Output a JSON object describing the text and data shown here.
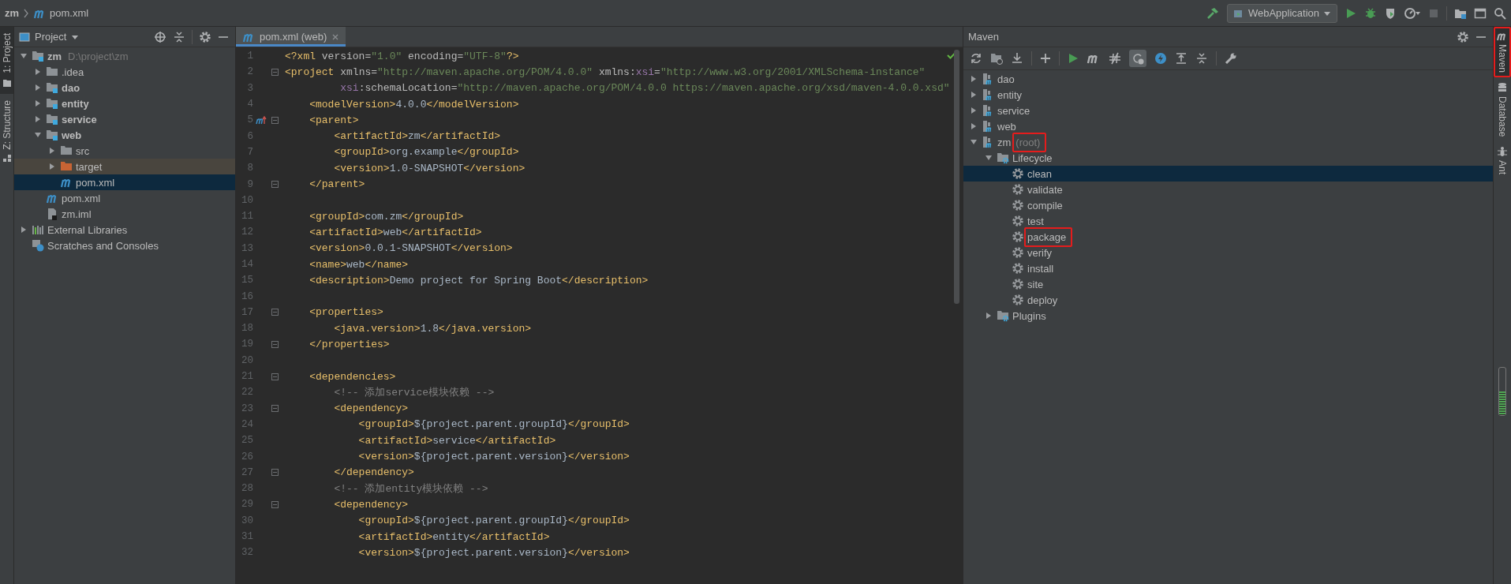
{
  "top_bar": {
    "breadcrumbs": [
      {
        "label": "zm",
        "kind": "project"
      },
      {
        "label": "pom.xml",
        "kind": "pom"
      }
    ],
    "run_config": "WebApplication"
  },
  "left_stripe": [
    {
      "label": "1: Project",
      "selected": true,
      "kind": "project"
    },
    {
      "label": "Z: Structure",
      "selected": false,
      "kind": "structure"
    }
  ],
  "project_panel": {
    "title": "Project",
    "tree": [
      {
        "label": "zm",
        "hint": "D:\\project\\zm",
        "kind": "module",
        "expanded": true,
        "selected": false,
        "children": [
          {
            "label": ".idea",
            "kind": "folder",
            "expanded": false,
            "selected": false
          },
          {
            "label": "dao",
            "kind": "module",
            "expanded": false,
            "selected": false
          },
          {
            "label": "entity",
            "kind": "module",
            "expanded": false,
            "selected": false
          },
          {
            "label": "service",
            "kind": "module",
            "expanded": false,
            "selected": false
          },
          {
            "label": "web",
            "kind": "module",
            "expanded": true,
            "selected": false,
            "children": [
              {
                "label": "src",
                "kind": "folder",
                "expanded": false,
                "selected": false
              },
              {
                "label": "target",
                "kind": "excluded",
                "expanded": false,
                "selected": false
              },
              {
                "label": "pom.xml",
                "kind": "pom",
                "selected": true
              }
            ]
          },
          {
            "label": "pom.xml",
            "kind": "pom",
            "selected": false
          },
          {
            "label": "zm.iml",
            "kind": "iml",
            "selected": false
          }
        ]
      },
      {
        "label": "External Libraries",
        "kind": "libraries",
        "expanded": false,
        "selected": false
      },
      {
        "label": "Scratches and Consoles",
        "kind": "scratches",
        "selected": false
      }
    ]
  },
  "editor": {
    "tabs": [
      {
        "label": "pom.xml (web)",
        "selected": true
      }
    ],
    "lines": [
      {
        "number": "1",
        "fold": false,
        "override": false,
        "tokens": [
          {
            "kind": "t",
            "text": "<?xml"
          },
          {
            "kind": "a",
            "text": " version="
          },
          {
            "kind": "v",
            "text": "\"1.0\""
          },
          {
            "kind": "a",
            "text": " encoding="
          },
          {
            "kind": "v",
            "text": "\"UTF-8\""
          },
          {
            "kind": "t",
            "text": "?>"
          }
        ]
      },
      {
        "number": "2",
        "fold": true,
        "override": false,
        "tokens": [
          {
            "kind": "t",
            "text": "<project"
          },
          {
            "kind": "a",
            "text": " xmlns="
          },
          {
            "kind": "v",
            "text": "\"http://maven.apache.org/POM/4.0.0\""
          },
          {
            "kind": "a",
            "text": " xmlns:"
          },
          {
            "kind": "n",
            "text": "xsi"
          },
          {
            "kind": "a",
            "text": "="
          },
          {
            "kind": "v",
            "text": "\"http://www.w3.org/2001/XMLSchema-instance\""
          }
        ]
      },
      {
        "number": "3",
        "fold": false,
        "override": false,
        "tokens": [
          {
            "kind": "n",
            "text": "         xsi"
          },
          {
            "kind": "a",
            "text": ":schemaLocation="
          },
          {
            "kind": "v",
            "text": "\"http://maven.apache.org/POM/4.0.0 https://maven.apache.org/xsd/maven-4.0.0.xsd\""
          }
        ]
      },
      {
        "number": "4",
        "fold": false,
        "override": false,
        "tokens": [
          {
            "kind": "t",
            "text": "    <modelVersion>"
          },
          {
            "kind": "x",
            "text": "4.0.0"
          },
          {
            "kind": "t",
            "text": "</modelVersion>"
          }
        ]
      },
      {
        "number": "5",
        "fold": true,
        "override": true,
        "tokens": [
          {
            "kind": "t",
            "text": "    <parent>"
          }
        ]
      },
      {
        "number": "6",
        "fold": false,
        "override": false,
        "tokens": [
          {
            "kind": "t",
            "text": "        <artifactId>"
          },
          {
            "kind": "x",
            "text": "zm"
          },
          {
            "kind": "t",
            "text": "</artifactId>"
          }
        ]
      },
      {
        "number": "7",
        "fold": false,
        "override": false,
        "tokens": [
          {
            "kind": "t",
            "text": "        <groupId>"
          },
          {
            "kind": "x",
            "text": "org.example"
          },
          {
            "kind": "t",
            "text": "</groupId>"
          }
        ]
      },
      {
        "number": "8",
        "fold": false,
        "override": false,
        "tokens": [
          {
            "kind": "t",
            "text": "        <version>"
          },
          {
            "kind": "x",
            "text": "1.0-SNAPSHOT"
          },
          {
            "kind": "t",
            "text": "</version>"
          }
        ]
      },
      {
        "number": "9",
        "fold": true,
        "override": false,
        "tokens": [
          {
            "kind": "t",
            "text": "    </parent>"
          }
        ]
      },
      {
        "number": "10",
        "fold": false,
        "override": false
      },
      {
        "number": "11",
        "fold": false,
        "override": false,
        "tokens": [
          {
            "kind": "t",
            "text": "    <groupId>"
          },
          {
            "kind": "x",
            "text": "com.zm"
          },
          {
            "kind": "t",
            "text": "</groupId>"
          }
        ]
      },
      {
        "number": "12",
        "fold": false,
        "override": false,
        "tokens": [
          {
            "kind": "t",
            "text": "    <artifactId>"
          },
          {
            "kind": "x",
            "text": "web"
          },
          {
            "kind": "t",
            "text": "</artifactId>"
          }
        ]
      },
      {
        "number": "13",
        "fold": false,
        "override": false,
        "tokens": [
          {
            "kind": "t",
            "text": "    <version>"
          },
          {
            "kind": "x",
            "text": "0.0.1-SNAPSHOT"
          },
          {
            "kind": "t",
            "text": "</version>"
          }
        ]
      },
      {
        "number": "14",
        "fold": false,
        "override": false,
        "tokens": [
          {
            "kind": "t",
            "text": "    <name>"
          },
          {
            "kind": "x",
            "text": "web"
          },
          {
            "kind": "t",
            "text": "</name>"
          }
        ]
      },
      {
        "number": "15",
        "fold": false,
        "override": false,
        "tokens": [
          {
            "kind": "t",
            "text": "    <description>"
          },
          {
            "kind": "x",
            "text": "Demo project for Spring Boot"
          },
          {
            "kind": "t",
            "text": "</description>"
          }
        ]
      },
      {
        "number": "16",
        "fold": false,
        "override": false
      },
      {
        "number": "17",
        "fold": true,
        "override": false,
        "tokens": [
          {
            "kind": "t",
            "text": "    <properties>"
          }
        ]
      },
      {
        "number": "18",
        "fold": false,
        "override": false,
        "tokens": [
          {
            "kind": "t",
            "text": "        <java.version>"
          },
          {
            "kind": "x",
            "text": "1.8"
          },
          {
            "kind": "t",
            "text": "</java.version>"
          }
        ]
      },
      {
        "number": "19",
        "fold": true,
        "override": false,
        "tokens": [
          {
            "kind": "t",
            "text": "    </properties>"
          }
        ]
      },
      {
        "number": "20",
        "fold": false,
        "override": false
      },
      {
        "number": "21",
        "fold": true,
        "override": false,
        "tokens": [
          {
            "kind": "t",
            "text": "    <dependencies>"
          }
        ]
      },
      {
        "number": "22",
        "fold": false,
        "override": false,
        "tokens": [
          {
            "kind": "c",
            "text": "        <!-- 添加service模块依赖 -->"
          }
        ]
      },
      {
        "number": "23",
        "fold": true,
        "override": false,
        "tokens": [
          {
            "kind": "t",
            "text": "        <dependency>"
          }
        ]
      },
      {
        "number": "24",
        "fold": false,
        "override": false,
        "tokens": [
          {
            "kind": "t",
            "text": "            <groupId>"
          },
          {
            "kind": "x",
            "text": "${project.parent.groupId}"
          },
          {
            "kind": "t",
            "text": "</groupId>"
          }
        ]
      },
      {
        "number": "25",
        "fold": false,
        "override": false,
        "tokens": [
          {
            "kind": "t",
            "text": "            <artifactId>"
          },
          {
            "kind": "x",
            "text": "service"
          },
          {
            "kind": "t",
            "text": "</artifactId>"
          }
        ]
      },
      {
        "number": "26",
        "fold": false,
        "override": false,
        "tokens": [
          {
            "kind": "t",
            "text": "            <version>"
          },
          {
            "kind": "x",
            "text": "${project.parent.version}"
          },
          {
            "kind": "t",
            "text": "</version>"
          }
        ]
      },
      {
        "number": "27",
        "fold": true,
        "override": false,
        "tokens": [
          {
            "kind": "t",
            "text": "        </dependency>"
          }
        ]
      },
      {
        "number": "28",
        "fold": false,
        "override": false,
        "tokens": [
          {
            "kind": "c",
            "text": "        <!-- 添加entity模块依赖 -->"
          }
        ]
      },
      {
        "number": "29",
        "fold": true,
        "override": false,
        "tokens": [
          {
            "kind": "t",
            "text": "        <dependency>"
          }
        ]
      },
      {
        "number": "30",
        "fold": false,
        "override": false,
        "tokens": [
          {
            "kind": "t",
            "text": "            <groupId>"
          },
          {
            "kind": "x",
            "text": "${project.parent.groupId}"
          },
          {
            "kind": "t",
            "text": "</groupId>"
          }
        ]
      },
      {
        "number": "31",
        "fold": false,
        "override": false,
        "tokens": [
          {
            "kind": "t",
            "text": "            <artifactId>"
          },
          {
            "kind": "x",
            "text": "entity"
          },
          {
            "kind": "t",
            "text": "</artifactId>"
          }
        ]
      },
      {
        "number": "32",
        "fold": false,
        "override": false,
        "tokens": [
          {
            "kind": "t",
            "text": "            <version>"
          },
          {
            "kind": "x",
            "text": "${project.parent.version}"
          },
          {
            "kind": "t",
            "text": "</version>"
          }
        ]
      }
    ]
  },
  "maven_panel": {
    "title": "Maven",
    "tree": [
      {
        "label": "dao",
        "kind": "project",
        "expanded": false,
        "selected": false,
        "highlighted": false
      },
      {
        "label": "entity",
        "kind": "project",
        "expanded": false,
        "selected": false,
        "highlighted": false
      },
      {
        "label": "service",
        "kind": "project",
        "expanded": false,
        "selected": false,
        "highlighted": false
      },
      {
        "label": "web",
        "kind": "project",
        "expanded": false,
        "selected": false,
        "highlighted": false
      },
      {
        "label": "zm",
        "note": "(root)",
        "kind": "project",
        "expanded": true,
        "selected": false,
        "highlighted": true,
        "children": [
          {
            "label": "Lifecycle",
            "kind": "group",
            "expanded": true,
            "selected": false,
            "highlighted": false,
            "children": [
              {
                "label": "clean",
                "kind": "goal",
                "selected": true,
                "highlighted": false
              },
              {
                "label": "validate",
                "kind": "goal",
                "selected": false,
                "highlighted": false
              },
              {
                "label": "compile",
                "kind": "goal",
                "selected": false,
                "highlighted": false
              },
              {
                "label": "test",
                "kind": "goal",
                "selected": false,
                "highlighted": false
              },
              {
                "label": "package",
                "kind": "goal",
                "selected": false,
                "highlighted": true
              },
              {
                "label": "verify",
                "kind": "goal",
                "selected": false,
                "highlighted": false
              },
              {
                "label": "install",
                "kind": "goal",
                "selected": false,
                "highlighted": false
              },
              {
                "label": "site",
                "kind": "goal",
                "selected": false,
                "highlighted": false
              },
              {
                "label": "deploy",
                "kind": "goal",
                "selected": false,
                "highlighted": false
              }
            ]
          },
          {
            "label": "Plugins",
            "kind": "group",
            "expanded": false,
            "selected": false,
            "highlighted": false
          }
        ]
      }
    ]
  },
  "right_stripe": [
    {
      "label": "Maven",
      "kind": "maven",
      "selected": true,
      "highlighted": true
    },
    {
      "label": "Database",
      "kind": "database",
      "selected": false,
      "highlighted": false
    },
    {
      "label": "Ant",
      "kind": "ant",
      "selected": false,
      "highlighted": false
    }
  ]
}
